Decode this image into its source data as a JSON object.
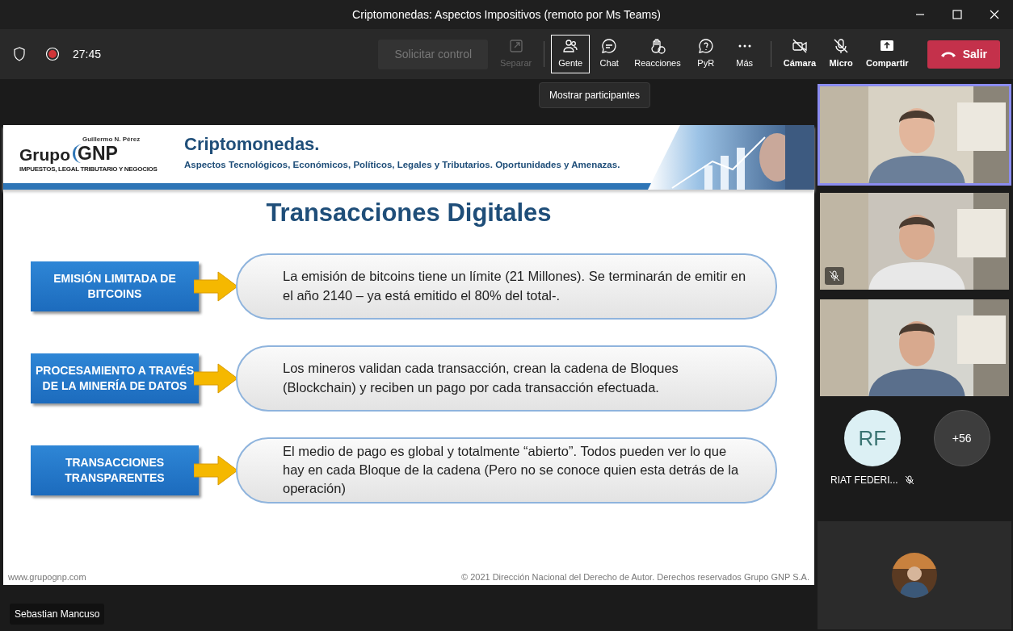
{
  "window": {
    "title": "Criptomonedas: Aspectos Impositivos (remoto por Ms Teams)"
  },
  "toolbar": {
    "recording": true,
    "timer": "27:45",
    "request_control": {
      "label": "Solicitar control",
      "disabled": true
    },
    "buttons": [
      {
        "label": "Separar",
        "disabled": true,
        "selected": false,
        "off": false
      },
      {
        "label": "Gente",
        "disabled": false,
        "selected": true,
        "off": false
      },
      {
        "label": "Chat",
        "disabled": false,
        "selected": false,
        "off": false
      },
      {
        "label": "Reacciones",
        "disabled": false,
        "selected": false,
        "off": false
      },
      {
        "label": "PyR",
        "disabled": false,
        "selected": false,
        "off": false
      },
      {
        "label": "Más",
        "disabled": false,
        "selected": false,
        "off": false
      },
      {
        "label": "Cámara",
        "disabled": false,
        "selected": false,
        "off": true
      },
      {
        "label": "Micro",
        "disabled": false,
        "selected": false,
        "off": true
      },
      {
        "label": "Compartir",
        "disabled": false,
        "selected": false,
        "off": false
      }
    ],
    "leave": "Salir"
  },
  "tooltip": "Mostrar participantes",
  "slide": {
    "logo": {
      "small": "Guillermo N. Pérez",
      "word": "Grupo",
      "brand": "GNP",
      "tagline": "IMPUESTOS, LEGAL TRIBUTARIO Y NEGOCIOS"
    },
    "title": "Criptomonedas.",
    "subtitle": "Aspectos Tecnológicos, Económicos, Políticos, Legales y Tributarios. Oportunidades y Amenazas.",
    "heading": "Transacciones Digitales",
    "rows": [
      {
        "label": "EMISIÓN LIMITADA DE BITCOINS",
        "text": "La emisión de bitcoins tiene un límite (21 Millones). Se terminarán de emitir en el año 2140 – ya está emitido el 80% del total-."
      },
      {
        "label": "PROCESAMIENTO A TRAVÉS DE LA MINERÍA DE DATOS",
        "text": "Los mineros validan cada transacción, crean la cadena de Bloques (Blockchain) y reciben un pago por cada transacción efectuada."
      },
      {
        "label": "TRANSACCIONES TRANSPARENTES",
        "text": "El medio de pago es global y totalmente “abierto”. Todos pueden ver lo que hay en cada Bloque de la cadena (Pero no se conoce quien esta detrás de la operación)"
      }
    ],
    "footer_left": "www.grupognp.com",
    "footer_right": "© 2021 Dirección Nacional del Derecho de Autor. Derechos reservados Grupo GNP S.A."
  },
  "presenter": "Sebastian Mancuso",
  "videos": [
    {
      "selected": true,
      "muted": false
    },
    {
      "selected": false,
      "muted": true
    },
    {
      "selected": false,
      "muted": false
    }
  ],
  "avatars": [
    {
      "initials": "RF",
      "name": "RIAT FEDERI...",
      "muted": true
    }
  ],
  "overflow": "+56"
}
